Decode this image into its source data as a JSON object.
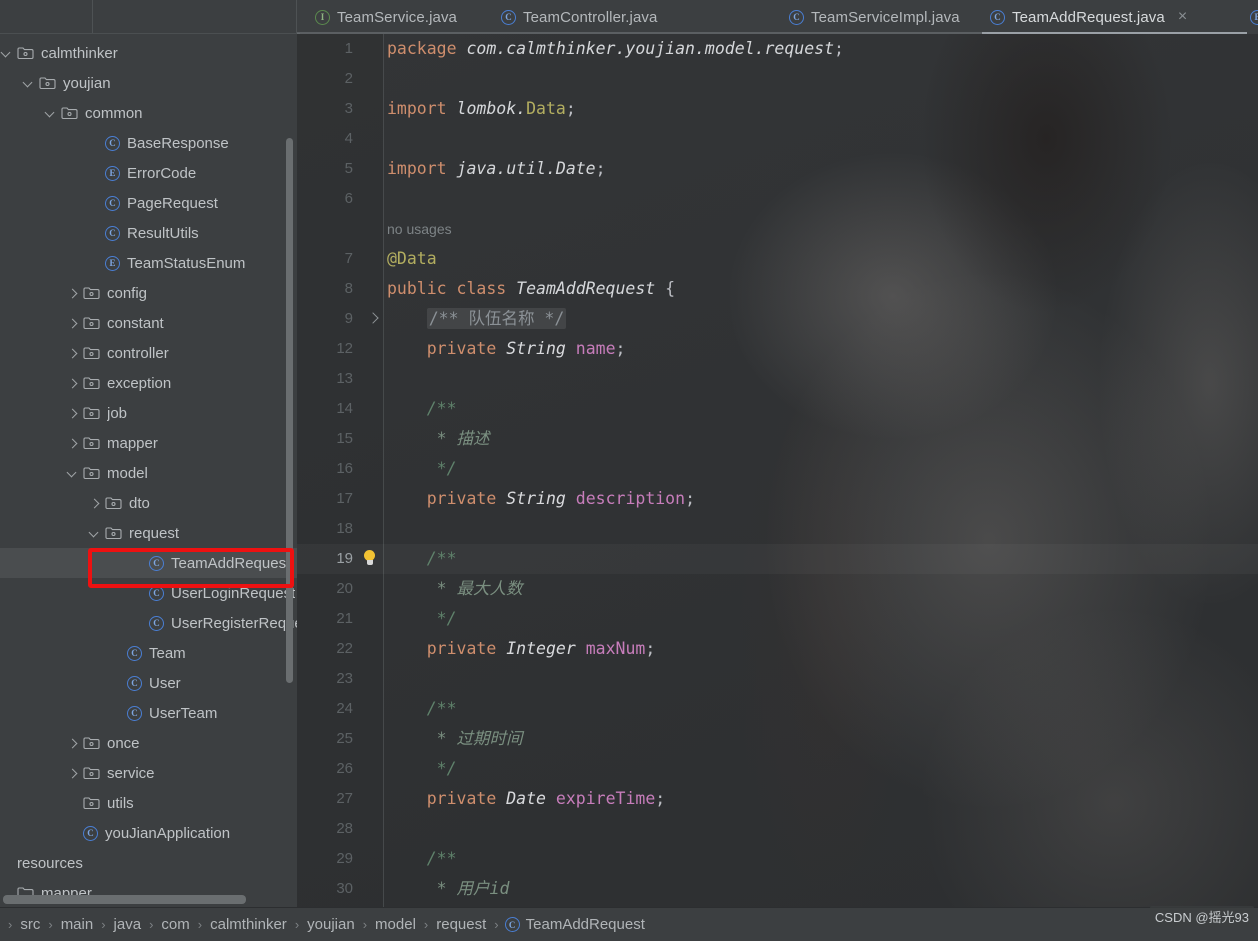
{
  "window": {
    "theme_bg": "#3c3f41",
    "editor_bg": "#2f3133",
    "accent_blue": "#4a7fd4",
    "annotation_color": "#ee1111"
  },
  "tabs": [
    {
      "label": "TeamService.java",
      "icon": "interface-icon",
      "icon_letter": "I",
      "active": false,
      "closable": false
    },
    {
      "label": "TeamController.java",
      "icon": "class-icon",
      "icon_letter": "C",
      "active": false,
      "closable": false
    },
    {
      "label": "TeamServiceImpl.java",
      "icon": "class-icon",
      "icon_letter": "C",
      "active": false,
      "closable": false
    },
    {
      "label": "TeamAddRequest.java",
      "icon": "class-icon",
      "icon_letter": "C",
      "active": true,
      "closable": true
    },
    {
      "label": "",
      "icon": "enum-icon",
      "icon_letter": "E",
      "active": false,
      "closable": false
    }
  ],
  "tab_close_glyph": "×",
  "sidebar": {
    "items": [
      {
        "label": "calmthinker",
        "indent": 0,
        "kind": "folder",
        "arrow": "open",
        "selected": false
      },
      {
        "label": "youjian",
        "indent": 1,
        "kind": "folder",
        "arrow": "open",
        "selected": false
      },
      {
        "label": "common",
        "indent": 2,
        "kind": "folder",
        "arrow": "open",
        "selected": false
      },
      {
        "label": "BaseResponse",
        "indent": 4,
        "kind": "class",
        "arrow": "none",
        "selected": false
      },
      {
        "label": "ErrorCode",
        "indent": 4,
        "kind": "enum",
        "arrow": "none",
        "selected": false
      },
      {
        "label": "PageRequest",
        "indent": 4,
        "kind": "class",
        "arrow": "none",
        "selected": false
      },
      {
        "label": "ResultUtils",
        "indent": 4,
        "kind": "class",
        "arrow": "none",
        "selected": false
      },
      {
        "label": "TeamStatusEnum",
        "indent": 4,
        "kind": "enum",
        "arrow": "none",
        "selected": false
      },
      {
        "label": "config",
        "indent": 3,
        "kind": "folder",
        "arrow": "closed",
        "selected": false
      },
      {
        "label": "constant",
        "indent": 3,
        "kind": "folder",
        "arrow": "closed",
        "selected": false
      },
      {
        "label": "controller",
        "indent": 3,
        "kind": "folder",
        "arrow": "closed",
        "selected": false
      },
      {
        "label": "exception",
        "indent": 3,
        "kind": "folder",
        "arrow": "closed",
        "selected": false
      },
      {
        "label": "job",
        "indent": 3,
        "kind": "folder",
        "arrow": "closed",
        "selected": false
      },
      {
        "label": "mapper",
        "indent": 3,
        "kind": "folder",
        "arrow": "closed",
        "selected": false
      },
      {
        "label": "model",
        "indent": 3,
        "kind": "folder",
        "arrow": "open",
        "selected": false
      },
      {
        "label": "dto",
        "indent": 4,
        "kind": "folder",
        "arrow": "closed",
        "selected": false
      },
      {
        "label": "request",
        "indent": 4,
        "kind": "folder",
        "arrow": "open",
        "selected": false
      },
      {
        "label": "TeamAddRequest",
        "indent": 6,
        "kind": "class",
        "arrow": "none",
        "selected": true
      },
      {
        "label": "UserLoginRequest",
        "indent": 6,
        "kind": "class",
        "arrow": "none",
        "selected": false
      },
      {
        "label": "UserRegisterReques",
        "indent": 6,
        "kind": "class",
        "arrow": "none",
        "selected": false
      },
      {
        "label": "Team",
        "indent": 5,
        "kind": "class",
        "arrow": "none",
        "selected": false
      },
      {
        "label": "User",
        "indent": 5,
        "kind": "class",
        "arrow": "none",
        "selected": false
      },
      {
        "label": "UserTeam",
        "indent": 5,
        "kind": "class",
        "arrow": "none",
        "selected": false
      },
      {
        "label": "once",
        "indent": 3,
        "kind": "folder",
        "arrow": "closed",
        "selected": false
      },
      {
        "label": "service",
        "indent": 3,
        "kind": "folder",
        "arrow": "closed",
        "selected": false
      },
      {
        "label": "utils",
        "indent": 3,
        "kind": "folder",
        "arrow": "none",
        "selected": false
      },
      {
        "label": "youJianApplication",
        "indent": 3,
        "kind": "springclass",
        "arrow": "none",
        "selected": false
      },
      {
        "label": "resources",
        "indent": -1,
        "kind": "plain",
        "arrow": "none",
        "selected": false
      },
      {
        "label": "mapper",
        "indent": -1,
        "kind": "plainfolder",
        "arrow": "none",
        "selected": false
      }
    ]
  },
  "editor": {
    "hint_no_usages": "no usages",
    "lines": [
      {
        "num": "1",
        "segments": [
          {
            "t": "package ",
            "c": "kw"
          },
          {
            "t": "com.calmthinker.youjian.model.request",
            "c": "pkg"
          },
          {
            "t": ";",
            "c": "pun"
          }
        ]
      },
      {
        "num": "2",
        "segments": []
      },
      {
        "num": "3",
        "segments": [
          {
            "t": "import ",
            "c": "kw"
          },
          {
            "t": "lombok.",
            "c": "pkg"
          },
          {
            "t": "Data",
            "c": "ann"
          },
          {
            "t": ";",
            "c": "pun"
          }
        ]
      },
      {
        "num": "4",
        "segments": []
      },
      {
        "num": "5",
        "segments": [
          {
            "t": "import ",
            "c": "kw"
          },
          {
            "t": "java.util.Date",
            "c": "pkg"
          },
          {
            "t": ";",
            "c": "pun"
          }
        ]
      },
      {
        "num": "6",
        "segments": []
      },
      {
        "num": "",
        "hint": "no usages",
        "segments": []
      },
      {
        "num": "7",
        "segments": [
          {
            "t": "@Data",
            "c": "ann"
          }
        ]
      },
      {
        "num": "8",
        "segments": [
          {
            "t": "public class ",
            "c": "kw"
          },
          {
            "t": "TeamAddRequest",
            "c": "cls"
          },
          {
            "t": " {",
            "c": "pun"
          }
        ]
      },
      {
        "num": "9",
        "fold": true,
        "segments": [
          {
            "t": "    ",
            "c": "pun"
          },
          {
            "t": "/** 队伍名称 */",
            "c": "fldcmt",
            "folded": true
          }
        ]
      },
      {
        "num": "12",
        "segments": [
          {
            "t": "    ",
            "c": "pun"
          },
          {
            "t": "private ",
            "c": "kw"
          },
          {
            "t": "String",
            "c": "typ"
          },
          {
            "t": " ",
            "c": "pun"
          },
          {
            "t": "name",
            "c": "fld"
          },
          {
            "t": ";",
            "c": "pun"
          }
        ]
      },
      {
        "num": "13",
        "segments": []
      },
      {
        "num": "14",
        "segments": [
          {
            "t": "    /**",
            "c": "cmt"
          }
        ]
      },
      {
        "num": "15",
        "segments": [
          {
            "t": "     * 描述",
            "c": "cmt2"
          }
        ]
      },
      {
        "num": "16",
        "segments": [
          {
            "t": "     */",
            "c": "cmt"
          }
        ]
      },
      {
        "num": "17",
        "segments": [
          {
            "t": "    ",
            "c": "pun"
          },
          {
            "t": "private ",
            "c": "kw"
          },
          {
            "t": "String",
            "c": "typ"
          },
          {
            "t": " ",
            "c": "pun"
          },
          {
            "t": "description",
            "c": "fld"
          },
          {
            "t": ";",
            "c": "pun"
          }
        ]
      },
      {
        "num": "18",
        "segments": []
      },
      {
        "num": "19",
        "current": true,
        "bulb": true,
        "segments": [
          {
            "t": "    /**",
            "c": "cmt"
          }
        ]
      },
      {
        "num": "20",
        "segments": [
          {
            "t": "     * 最大人数",
            "c": "cmt2"
          }
        ]
      },
      {
        "num": "21",
        "segments": [
          {
            "t": "     */",
            "c": "cmt"
          }
        ]
      },
      {
        "num": "22",
        "segments": [
          {
            "t": "    ",
            "c": "pun"
          },
          {
            "t": "private ",
            "c": "kw"
          },
          {
            "t": "Integer",
            "c": "typ"
          },
          {
            "t": " ",
            "c": "pun"
          },
          {
            "t": "maxNum",
            "c": "fld"
          },
          {
            "t": ";",
            "c": "pun"
          }
        ]
      },
      {
        "num": "23",
        "segments": []
      },
      {
        "num": "24",
        "segments": [
          {
            "t": "    /**",
            "c": "cmt"
          }
        ]
      },
      {
        "num": "25",
        "segments": [
          {
            "t": "     * 过期时间",
            "c": "cmt2"
          }
        ]
      },
      {
        "num": "26",
        "segments": [
          {
            "t": "     */",
            "c": "cmt"
          }
        ]
      },
      {
        "num": "27",
        "segments": [
          {
            "t": "    ",
            "c": "pun"
          },
          {
            "t": "private ",
            "c": "kw"
          },
          {
            "t": "Date",
            "c": "typ"
          },
          {
            "t": " ",
            "c": "pun"
          },
          {
            "t": "expireTime",
            "c": "fld"
          },
          {
            "t": ";",
            "c": "pun"
          }
        ]
      },
      {
        "num": "28",
        "segments": []
      },
      {
        "num": "29",
        "segments": [
          {
            "t": "    /**",
            "c": "cmt"
          }
        ]
      },
      {
        "num": "30",
        "segments": [
          {
            "t": "     * 用户id",
            "c": "cmt2"
          }
        ]
      }
    ]
  },
  "breadcrumb": {
    "separator": "›",
    "crumbs": [
      "src",
      "main",
      "java",
      "com",
      "calmthinker",
      "youjian",
      "model",
      "request"
    ],
    "file": "TeamAddRequest",
    "file_icon_letter": "C"
  },
  "watermark": "CSDN @摇光93"
}
